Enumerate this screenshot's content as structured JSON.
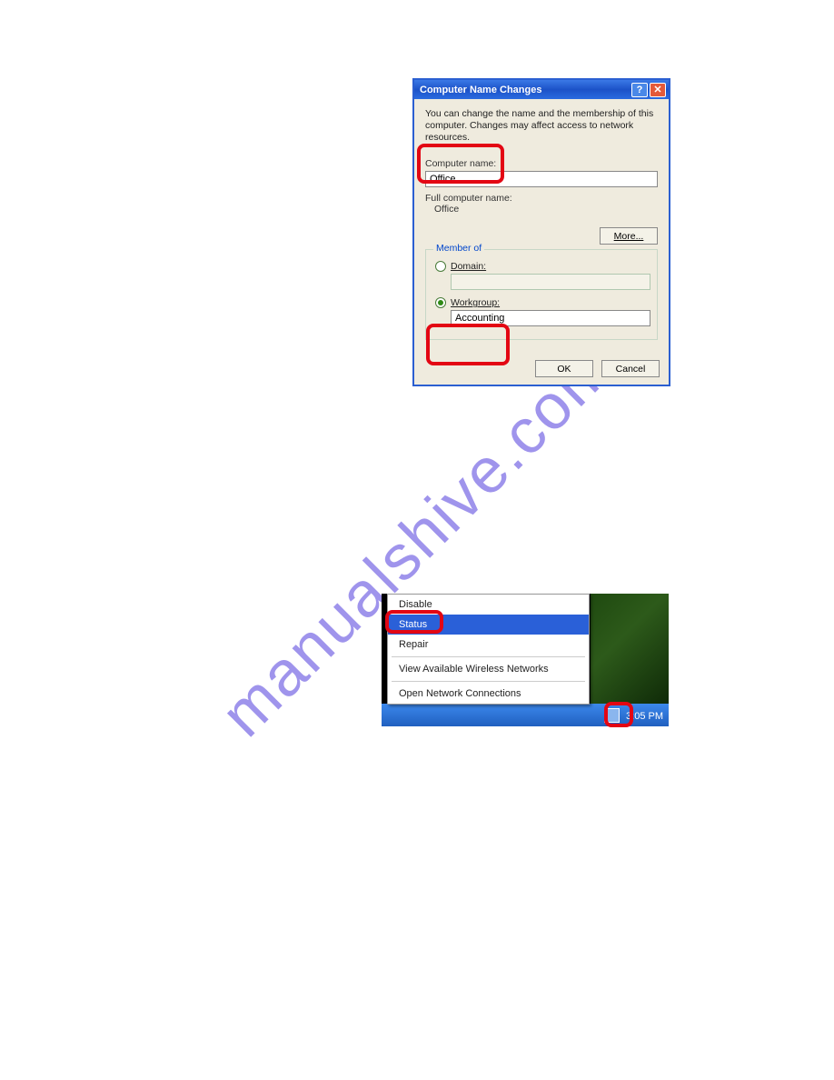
{
  "watermark": "manualshive.com",
  "dialog": {
    "title": "Computer Name Changes",
    "desc": "You can change the name and the membership of this computer. Changes may affect access to network resources.",
    "computer_name_label": "Computer name:",
    "computer_name_value": "Office",
    "full_label": "Full computer name:",
    "full_value": "Office",
    "more_btn": "More...",
    "member_of": "Member of",
    "domain_label": "Domain:",
    "domain_value": "",
    "workgroup_label": "Workgroup:",
    "workgroup_value": "Accounting",
    "ok": "OK",
    "cancel": "Cancel"
  },
  "context_menu": {
    "items": {
      "disable": "Disable",
      "status": "Status",
      "repair": "Repair",
      "view_networks": "View Available Wireless Networks",
      "open_connections": "Open Network Connections"
    },
    "time": "3:05 PM"
  }
}
